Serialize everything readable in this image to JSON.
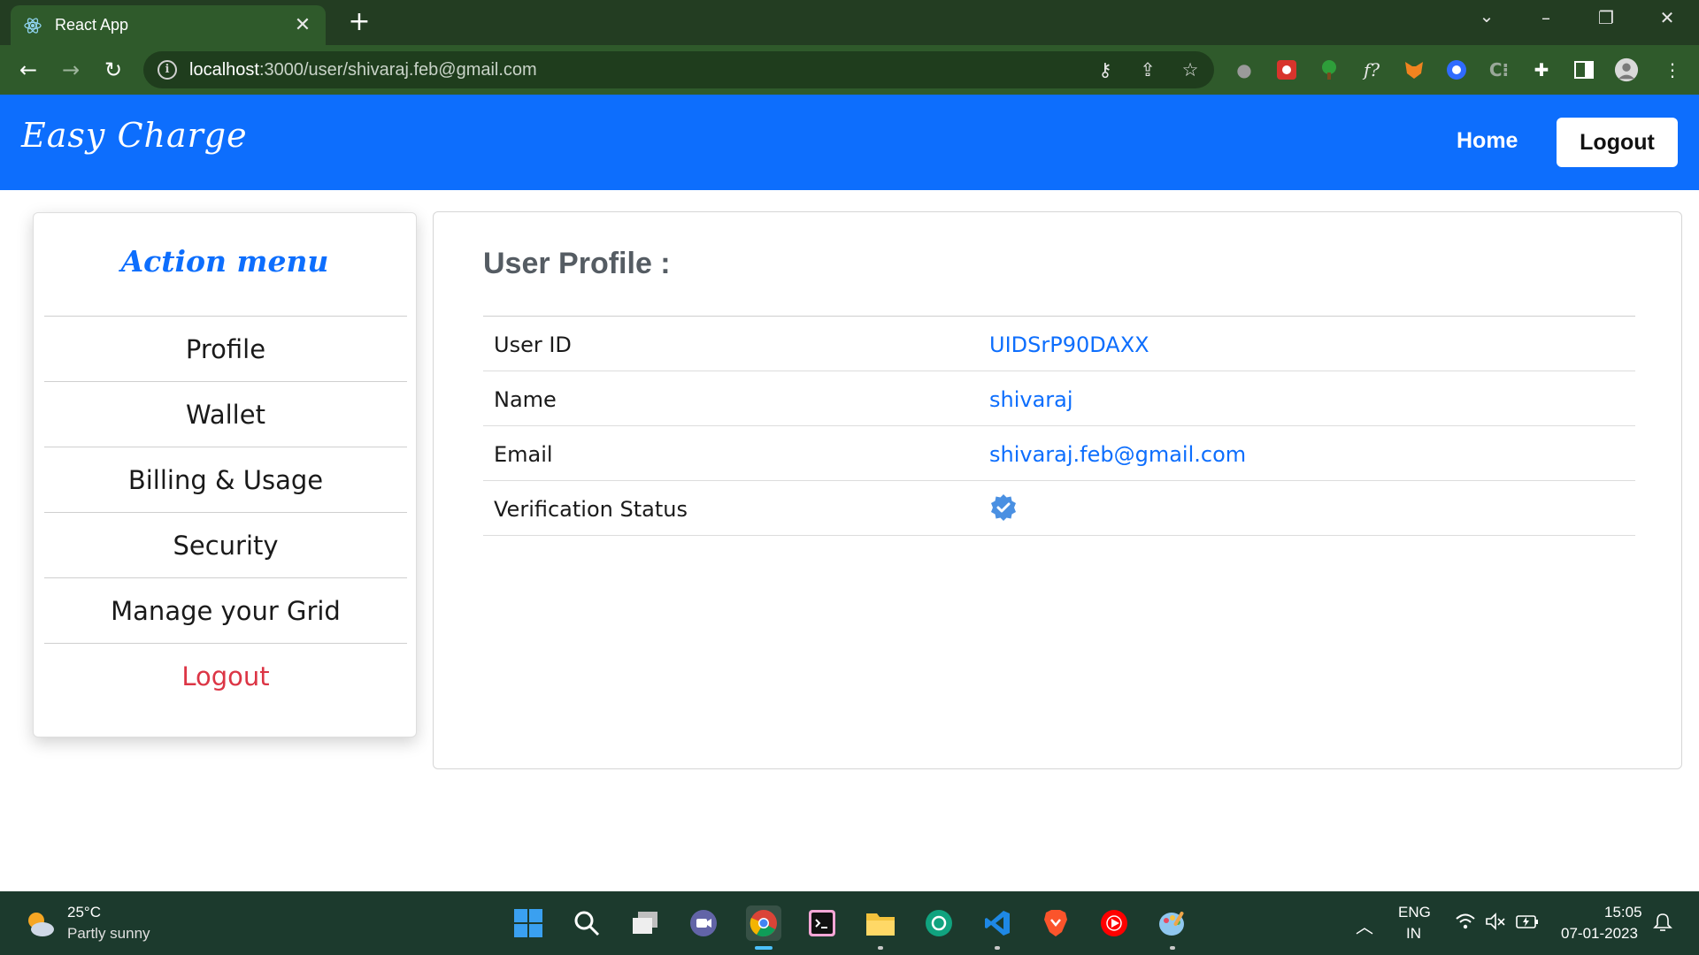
{
  "browser": {
    "tab_title": "React App",
    "tab_close": "✕",
    "new_tab": "+",
    "url_host": "localhost",
    "url_path": ":3000/user/shivaraj.feb@gmail.com",
    "window_controls": [
      "chevron-down",
      "minimize",
      "restore",
      "close"
    ]
  },
  "navbar": {
    "brand": "Easy Charge",
    "home": "Home",
    "logout": "Logout",
    "color": "#0d6efd"
  },
  "sidebar": {
    "title": "Action menu",
    "items": [
      {
        "label": "Profile"
      },
      {
        "label": "Wallet"
      },
      {
        "label": "Billing & Usage"
      },
      {
        "label": "Security"
      },
      {
        "label": "Manage your Grid"
      },
      {
        "label": "Logout",
        "color": "#dc3545"
      }
    ]
  },
  "profile": {
    "title": "User Profile :",
    "rows": [
      {
        "label": "User ID",
        "value": "UIDSrP90DAXX"
      },
      {
        "label": "Name",
        "value": "shivaraj"
      },
      {
        "label": "Email",
        "value": "shivaraj.feb@gmail.com"
      },
      {
        "label": "Verification Status",
        "value": "",
        "icon": "verified-badge-icon"
      }
    ]
  },
  "taskbar": {
    "weather_temp": "25°C",
    "weather_desc": "Partly sunny",
    "lang_top": "ENG",
    "lang_bottom": "IN",
    "time": "15:05",
    "date": "07-01-2023"
  }
}
